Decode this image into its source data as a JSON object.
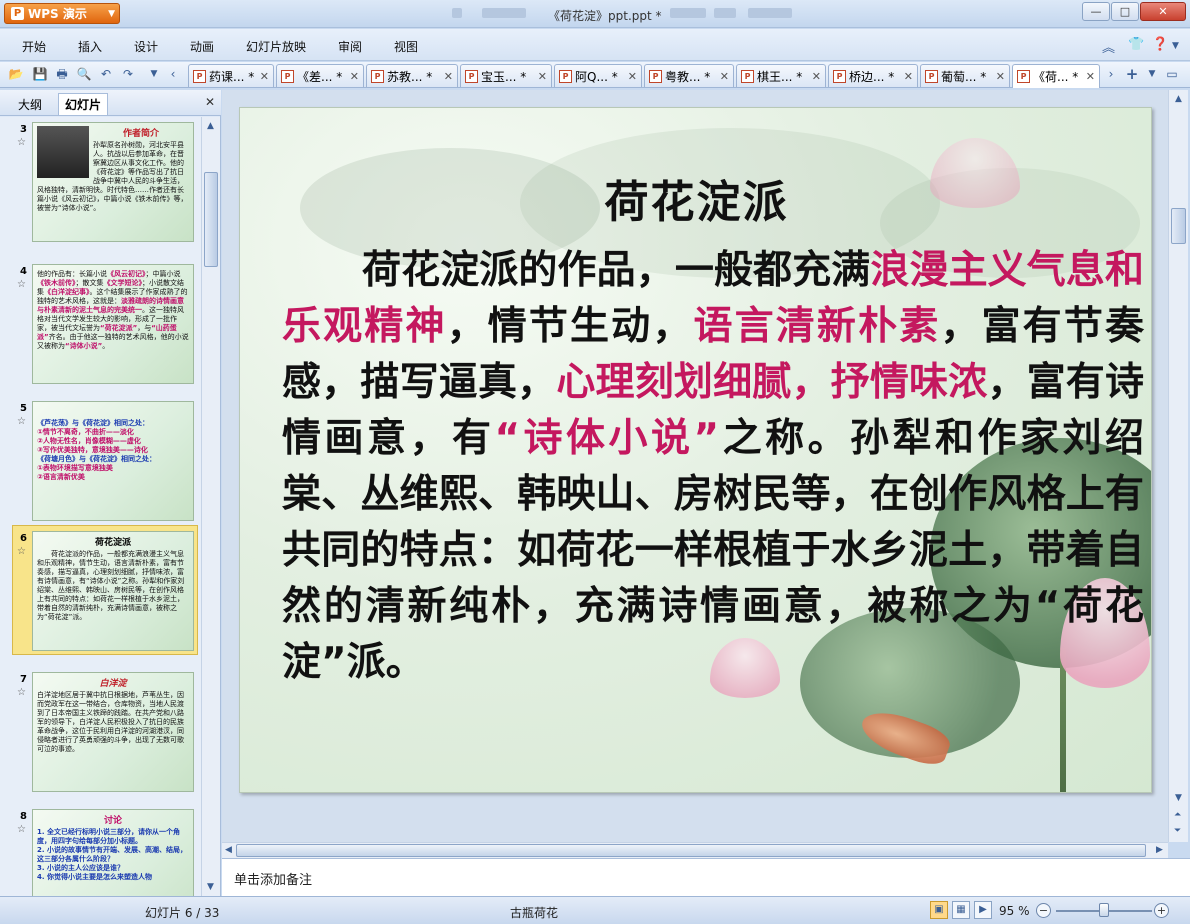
{
  "app": {
    "button_label": "WPS 演示",
    "window_title": "《荷花淀》ppt.ppt *"
  },
  "menu": [
    "开始",
    "插入",
    "设计",
    "动画",
    "幻灯片放映",
    "审阅",
    "视图"
  ],
  "tabs": [
    {
      "label": "药课... *"
    },
    {
      "label": "《差... *"
    },
    {
      "label": "苏教... *"
    },
    {
      "label": "宝玉... *"
    },
    {
      "label": "阿Q... *"
    },
    {
      "label": "粤教... *"
    },
    {
      "label": "棋王... *"
    },
    {
      "label": "桥边... *"
    },
    {
      "label": "葡萄... *"
    },
    {
      "label": "《荷... *"
    }
  ],
  "left_panel": {
    "tab_outline": "大纲",
    "tab_slides": "幻灯片",
    "thumbnails": [
      {
        "num": "3",
        "title": "作者简介",
        "body": "孙犁原名孙树勋，河北安平县人。抗战以后参加革命，在晋察冀边区从事文化工作。他的《荷花淀》等作品写出了抗日战争中冀中人民的斗争生活，风格独特，清新明快。时代特色……作者还有长篇小说《风云初记》，中篇小说《铁木前传》等，被誉为“诗体小说”。"
      },
      {
        "num": "4",
        "title": "",
        "body_parts": [
          {
            "t": "他的作品有：长篇小说",
            "c": ""
          },
          {
            "t": "《风云初记》",
            "c": "pk"
          },
          {
            "t": "；中篇小说",
            "c": ""
          },
          {
            "t": "《铁木前传》",
            "c": "pk"
          },
          {
            "t": "；散文集",
            "c": ""
          },
          {
            "t": "《文学短论》",
            "c": "pk"
          },
          {
            "t": "；小说散文结集",
            "c": ""
          },
          {
            "t": "《白洋淀纪事》",
            "c": "pk"
          },
          {
            "t": "。这个结集展示了作家成熟了的独特的艺术风格，这就是：",
            "c": ""
          },
          {
            "t": "淡雅疏朗的诗情画意与朴素清新的泥土气息的完美统一",
            "c": "pk"
          },
          {
            "t": "。这一独特风格对当代文学发生较大的影响，形成了一批作家，被当代文坛誉为",
            "c": ""
          },
          {
            "t": "“荷花淀派”",
            "c": "pk"
          },
          {
            "t": "，与",
            "c": ""
          },
          {
            "t": "“山药蛋派”",
            "c": "pk"
          },
          {
            "t": "齐名。由于他这一独特的艺术风格，他的小说又被称为",
            "c": ""
          },
          {
            "t": "“诗体小说”",
            "c": "pk"
          },
          {
            "t": "。",
            "c": ""
          }
        ]
      },
      {
        "num": "5",
        "title": "",
        "lines": [
          "《芦花荡》与《荷花淀》相同之处：",
          "①情节不离奇，不曲折——淡化",
          "②人物无性名，肖像模糊——虚化",
          "③写作优美独特，意境独美——诗化",
          "《荷塘月色》与《荷花淀》相同之处：",
          "①表物环境描写意境独美",
          "②语言清新优美"
        ]
      },
      {
        "num": "6",
        "title": "荷花淀派",
        "body": "荷花淀派的作品，一般都充满浪漫主义气息和乐观精神，情节生动，语言清新朴素，富有节奏感，描写逼真，心理刻划细腻，抒情味浓，富有诗情画意，有“诗体小说”之称。孙犁和作家刘绍棠、丛维熙、韩映山、房树民等，在创作风格上有共同的特点：如荷花一样根植于水乡泥土，带着自然的清新纯朴，充满诗情画意，被称之为“荷花淀”派。"
      },
      {
        "num": "7",
        "title": "白洋淀",
        "body": "白洋淀地区居于冀中抗日根据地，芦苇丛生，因而党政军在这一带结合，仓库物资，当地人民渡到了日本帝国主义铁蹄的践踏。在共产党和八路军的领导下，白洋淀人民积极投入了抗日的民族革命战争，这位于民利用白洋淀的河湖港汊，同侵略者进行了英勇顽强的斗争，出现了无数可歌可泣的事迹。"
      },
      {
        "num": "8",
        "title": "讨论",
        "lines": [
          "1. 全文已经行标明小说三部分，请你从一个角度，用四字句给每部分加小标题。",
          "2. 小说的故事情节有开端、发展、高潮、结局，这三部分各属什么阶段？",
          "3. 小说的主人公应该是谁？",
          "4. 你觉得小说主要是怎么来塑造人物"
        ]
      }
    ]
  },
  "slide": {
    "title": "荷花淀派",
    "body_segments": [
      {
        "text": "荷花淀派的作品，一般都充满",
        "highlight": false
      },
      {
        "text": "浪漫主义气息和乐观精神",
        "highlight": true
      },
      {
        "text": "，情节生动，",
        "highlight": false
      },
      {
        "text": "语言清新朴素",
        "highlight": true
      },
      {
        "text": "，富有节奏感，描写逼真，",
        "highlight": false
      },
      {
        "text": "心理刻划细腻，抒情味浓",
        "highlight": true
      },
      {
        "text": "，富有诗情画意，有",
        "highlight": false
      },
      {
        "text": "“诗体小说”",
        "highlight": true
      },
      {
        "text": "之称。孙犁和作家刘绍棠、丛维熙、韩映山、房树民等，在创作风格上有共同的特点：如荷花一样根植于水乡泥土，带着自然的清新纯朴，充满诗情画意，被称之为“荷花淀”派。",
        "highlight": false
      }
    ]
  },
  "notes_placeholder": "单击添加备注",
  "status": {
    "slide_counter": "幻灯片 6 / 33",
    "theme": "古瓶荷花",
    "zoom": "95 %",
    "zoom_level": 0.5
  },
  "colors": {
    "highlight": "#c4185f",
    "accent_orange": "#e0650e"
  }
}
